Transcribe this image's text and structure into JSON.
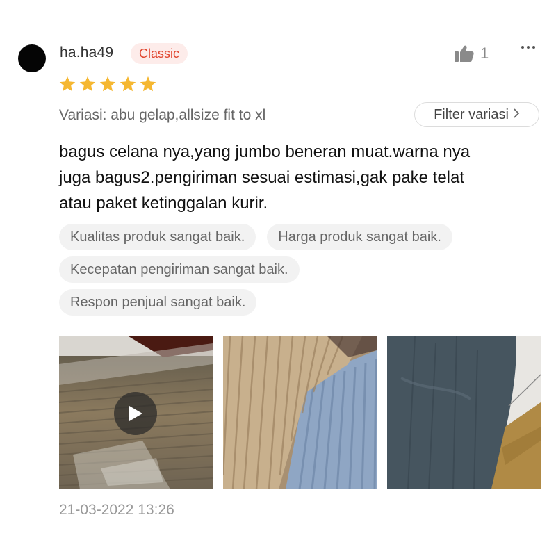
{
  "review": {
    "username": "ha.ha49",
    "badge": "Classic",
    "like_count": "1",
    "rating": 5,
    "variation": "Variasi: abu gelap,allsize fit to xl",
    "filter_label": "Filter variasi",
    "text_lines": [
      "bagus celana nya,yang jumbo beneran muat.warna nya",
      "juga bagus2.pengiriman sesuai estimasi,gak pake telat",
      "atau paket ketinggalan kurir."
    ],
    "tags": [
      "Kualitas produk sangat baik.",
      "Harga produk sangat baik.",
      "Kecepatan pengiriman sangat baik.",
      "Respon penjual sangat baik."
    ],
    "date": "21-03-2022 13:26"
  },
  "colors": {
    "badge_text": "#e0442d",
    "badge_bg": "#fdecea",
    "star": "#f5b731",
    "muted_text": "#666666"
  },
  "icons": {
    "like": "thumbs-up-icon",
    "more": "more-dots-icon",
    "star": "star-icon",
    "chevron": "chevron-right-icon",
    "play": "play-icon"
  }
}
